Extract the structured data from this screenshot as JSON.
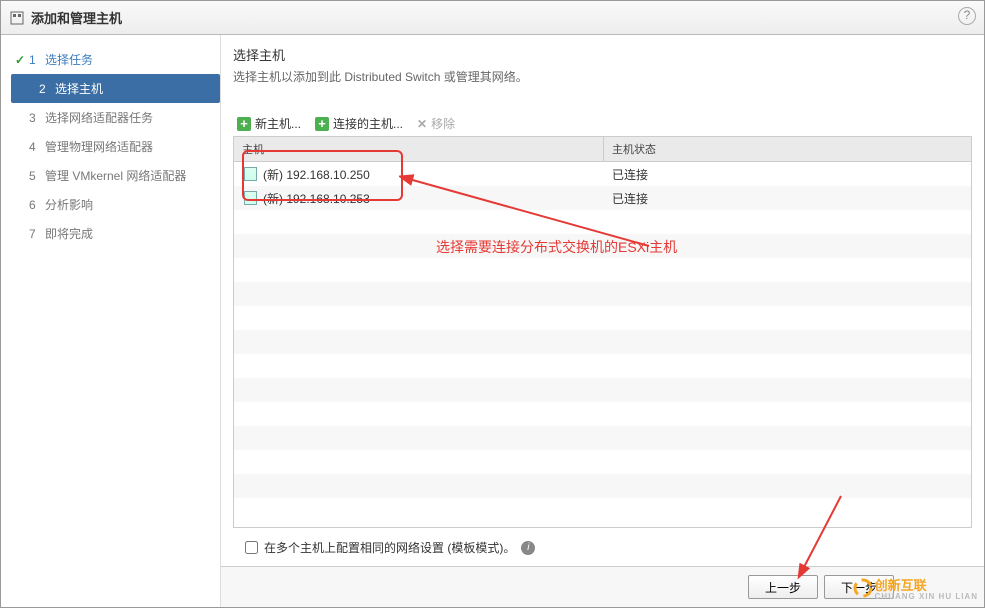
{
  "window": {
    "title": "添加和管理主机"
  },
  "sidebar": {
    "steps": [
      {
        "num": "1",
        "label": "选择任务",
        "state": "done"
      },
      {
        "num": "2",
        "label": "选择主机",
        "state": "active"
      },
      {
        "num": "3",
        "label": "选择网络适配器任务",
        "state": "todo"
      },
      {
        "num": "4",
        "label": "管理物理网络适配器",
        "state": "todo"
      },
      {
        "num": "5",
        "label": "管理 VMkernel 网络适配器",
        "state": "todo"
      },
      {
        "num": "6",
        "label": "分析影响",
        "state": "todo"
      },
      {
        "num": "7",
        "label": "即将完成",
        "state": "todo"
      }
    ]
  },
  "main": {
    "title": "选择主机",
    "subtitle": "选择主机以添加到此 Distributed Switch 或管理其网络。",
    "toolbar": {
      "newHost": "新主机...",
      "connectedHost": "连接的主机...",
      "remove": "移除"
    },
    "table": {
      "headers": {
        "host": "主机",
        "state": "主机状态"
      },
      "rows": [
        {
          "label": "(新) 192.168.10.250",
          "state": "已连接"
        },
        {
          "label": "(新) 192.168.10.253",
          "state": "已连接"
        }
      ]
    },
    "annotation": "选择需要连接分布式交换机的ESXi主机",
    "templateCheckbox": "在多个主机上配置相同的网络设置 (模板模式)。"
  },
  "footer": {
    "back": "上一步",
    "next": "下一步"
  },
  "logo": {
    "text": "创新互联",
    "sub": "CHUANG XIN HU LIAN"
  }
}
